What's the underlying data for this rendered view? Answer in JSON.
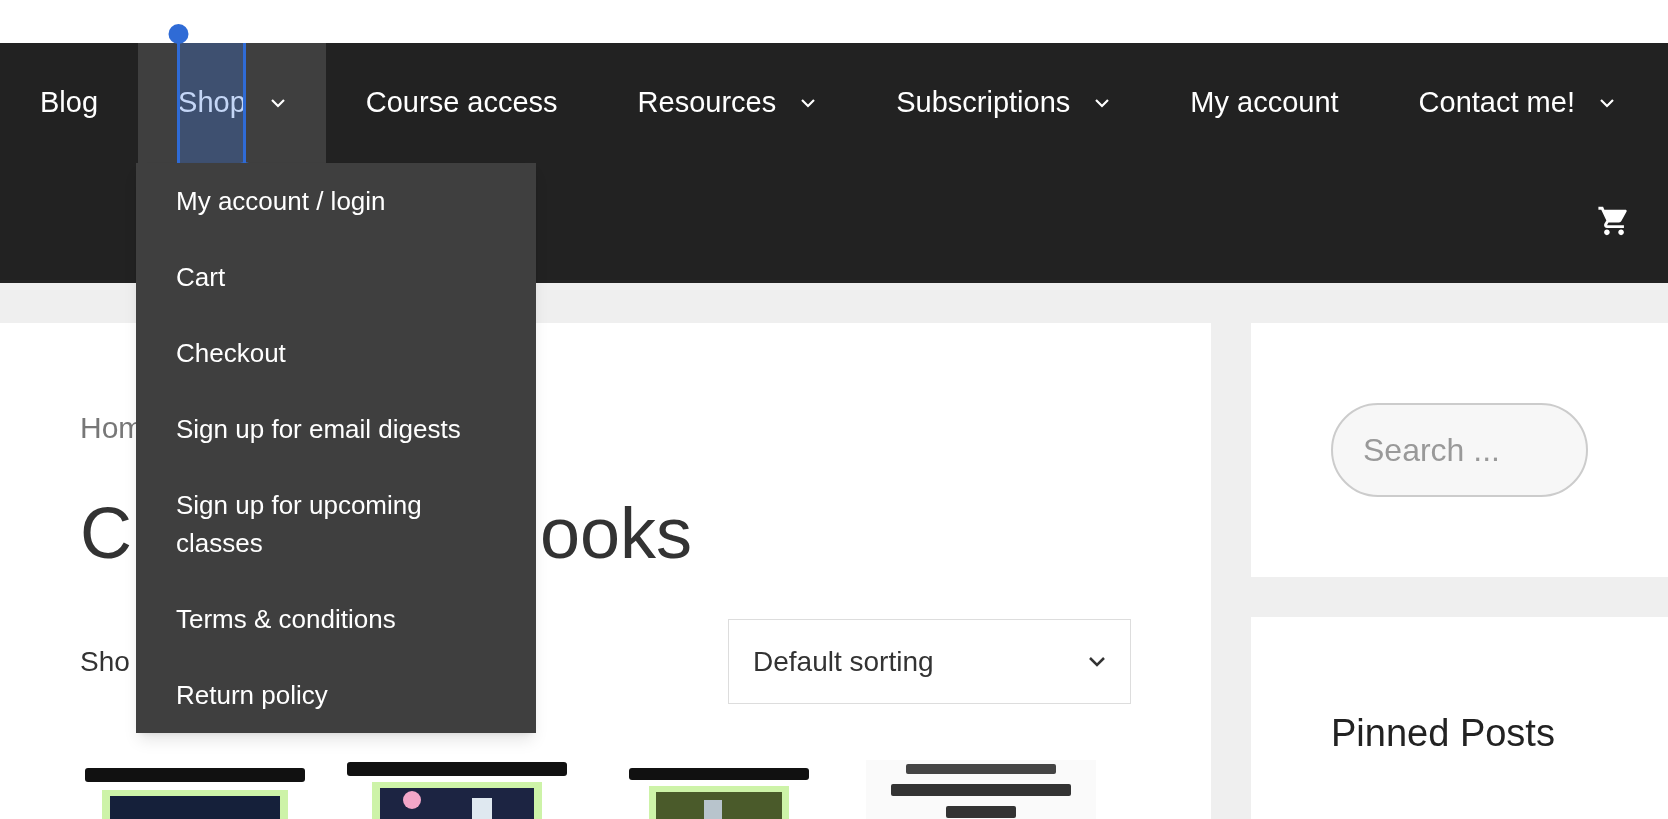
{
  "nav": {
    "items": [
      {
        "label": "Blog",
        "has_submenu": false,
        "selected": false,
        "text_selected": false
      },
      {
        "label": "Shop",
        "has_submenu": true,
        "selected": true,
        "text_selected": true
      },
      {
        "label": "Course access",
        "has_submenu": false,
        "selected": false,
        "text_selected": false
      },
      {
        "label": "Resources",
        "has_submenu": true,
        "selected": false,
        "text_selected": false
      },
      {
        "label": "Subscriptions",
        "has_submenu": true,
        "selected": false,
        "text_selected": false
      },
      {
        "label": "My account",
        "has_submenu": false,
        "selected": false,
        "text_selected": false
      },
      {
        "label": "Contact me!",
        "has_submenu": true,
        "selected": false,
        "text_selected": false
      }
    ]
  },
  "dropdown": {
    "items": [
      "My account / login",
      "Cart",
      "Checkout",
      "Sign up for email digests",
      "Sign up for upcoming classes",
      "Terms & conditions",
      "Return policy"
    ]
  },
  "breadcrumb": "Hom",
  "heading_parts": [
    "C",
    "ooks"
  ],
  "result_count": "Sho",
  "sorting": {
    "value": "Default sorting"
  },
  "search": {
    "placeholder": "Search ..."
  },
  "widget": {
    "title": "Pinned Posts"
  }
}
